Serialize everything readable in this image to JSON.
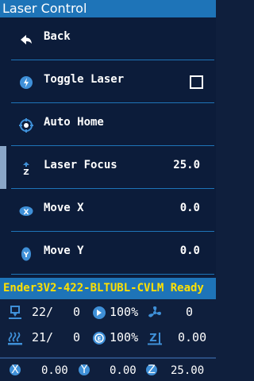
{
  "title": "Laser Control",
  "menu": [
    {
      "label": "Back",
      "icon": "back-arrow-icon"
    },
    {
      "label": "Toggle Laser",
      "icon": "laser-toggle-icon",
      "control": "checkbox",
      "checked": false
    },
    {
      "label": "Auto Home",
      "icon": "home-target-icon"
    },
    {
      "label": "Laser Focus",
      "icon": "focus-z-icon",
      "value": "25.0",
      "selected": true
    },
    {
      "label": "Move X",
      "icon": "move-x-icon",
      "value": "0.0"
    },
    {
      "label": "Move Y",
      "icon": "move-y-icon",
      "value": "0.0"
    }
  ],
  "status_message": "Ender3V2-422-BLTUBL-CVLM Ready",
  "info": {
    "hotend_temp": "22/",
    "hotend_target": "0",
    "feedrate": "100%",
    "fan": "0",
    "bed_temp": "21/",
    "bed_target": "0",
    "flow": "100%",
    "z_offset": "0.00"
  },
  "axes": {
    "x_label": "X",
    "x": "0.00",
    "y_label": "Y",
    "y": "0.00",
    "z_label": "Z",
    "z": "25.00"
  },
  "colors": {
    "accent": "#1e74b8",
    "background": "#0c1c3a",
    "status_text": "#ffe000",
    "icon": "#3f90d8"
  }
}
